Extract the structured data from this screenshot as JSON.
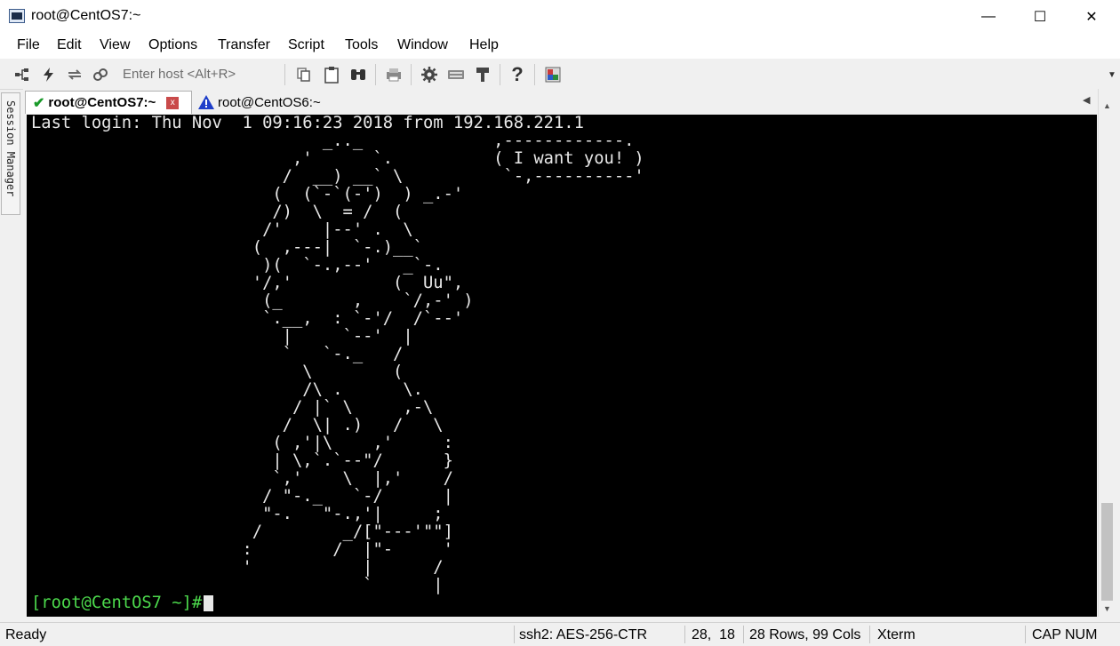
{
  "window": {
    "title": "root@CentOS7:~",
    "minimize_label": "—",
    "maximize_label": "☐",
    "close_label": "✕"
  },
  "menu": [
    "File",
    "Edit",
    "View",
    "Options",
    "Transfer",
    "Script",
    "Tools",
    "Window",
    "Help"
  ],
  "toolbar": {
    "host_placeholder": "Enter host <Alt+R>",
    "icons": [
      "connect-icon",
      "quick-connect-icon",
      "reconnect-icon",
      "disconnect-icon",
      "copy-icon",
      "paste-icon",
      "find-icon",
      "print-icon",
      "settings-icon",
      "keymap-icon",
      "sftp-icon",
      "help-icon",
      "screen-icon"
    ]
  },
  "session_manager": {
    "label": "Session Manager"
  },
  "tabs": [
    {
      "label": "root@CentOS7:~",
      "active": true,
      "status": "connected",
      "close_label": "x"
    },
    {
      "label": "root@CentOS6:~",
      "active": false,
      "status": "warning"
    }
  ],
  "terminal": {
    "lines": [
      "Last login: Thu Nov  1 09:16:23 2018 from 192.168.221.1",
      "                             _.._             ,------------.",
      "                          ,'      `.          ( I want you! )",
      "                         /  __) __` \\          `-,----------'",
      "                        (  (`-`(-')  ) _.-'",
      "                        /)  \\  = /  (",
      "                       /'    |--' .  \\",
      "                      (  ,---|  `-.)__`",
      "                       )(  `-.,--'   _`-.",
      "                      '/,'          (  Uu\",",
      "                       (_       ,    `/,-' )",
      "                       `.__,  : `-'/  /`--'",
      "                         |     `--'  |",
      "                         `   `-._   /",
      "                           \\        (",
      "                           /\\ .      \\.",
      "                          / |` \\     ,-\\",
      "                         /  \\| .)   /   \\",
      "                        ( ,'|\\    ,'     :",
      "                        | \\,`.`--\"/      }",
      "                        `,'    \\  |,'    /",
      "                       / \"-._   `-/      |",
      "                       \"-.   \"-.,'|     ;",
      "                      /        _/[\"---'\"\"]",
      "                     :        /  |\"-     '",
      "                     '           |      /",
      "                                 `      |"
    ],
    "prompt": "[root@CentOS7 ~]#"
  },
  "status_bar": {
    "ready": "Ready",
    "cipher": "ssh2: AES-256-CTR",
    "cursor_pos": "28,  18",
    "dimensions": "28 Rows, 99 Cols",
    "terminal_type": "Xterm",
    "caps": "CAP",
    "num": "NUM"
  }
}
